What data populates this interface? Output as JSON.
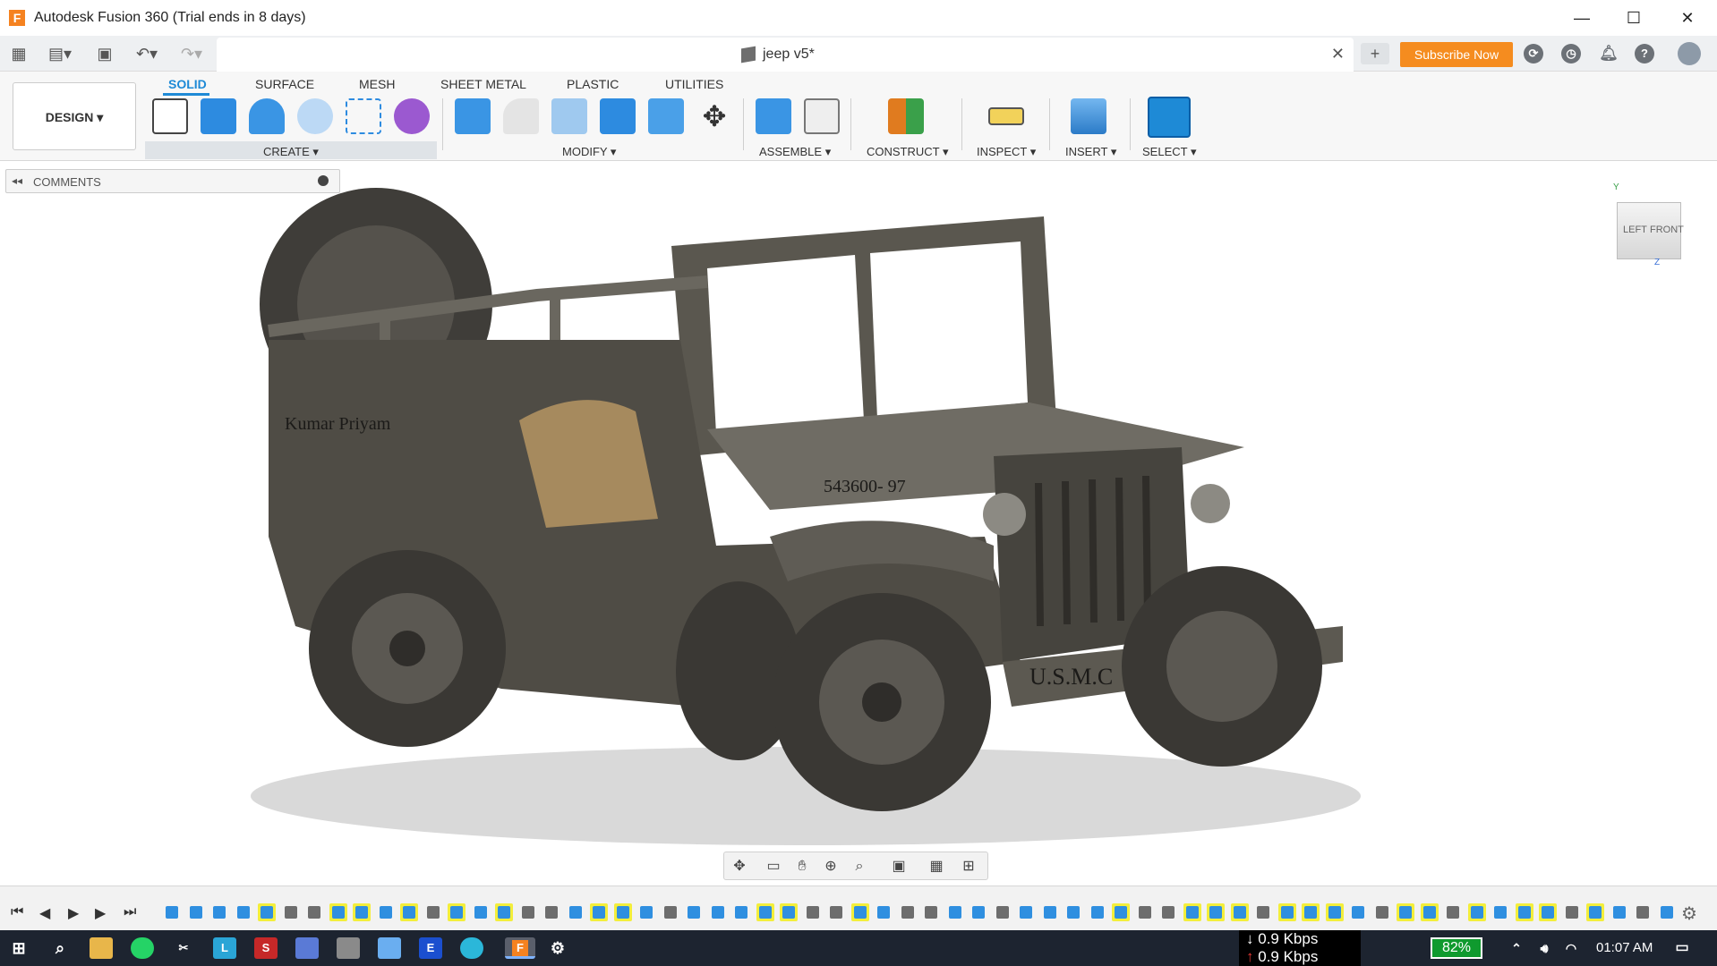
{
  "titlebar": {
    "title": "Autodesk Fusion 360 (Trial ends in 8 days)",
    "minimize": "—",
    "maximize": "☐",
    "close": "✕"
  },
  "tabbar": {
    "document_title": "jeep v5*",
    "subscribe_label": "Subscribe Now"
  },
  "ribbon": {
    "workspace": "DESIGN ▾",
    "tabs": [
      "SOLID",
      "SURFACE",
      "MESH",
      "SHEET METAL",
      "PLASTIC",
      "UTILITIES"
    ],
    "groups": [
      "CREATE ▾",
      "MODIFY ▾",
      "ASSEMBLE ▾",
      "CONSTRUCT ▾",
      "INSPECT ▾",
      "INSERT ▾",
      "SELECT ▾"
    ]
  },
  "comments": {
    "label": "COMMENTS"
  },
  "model": {
    "side_text": "Kumar Priyam",
    "hood_text": "543600- 97",
    "bumper_text": "U.S.M.C"
  },
  "viewcube": {
    "left": "LEFT",
    "front": "FRONT",
    "y_axis": "Y",
    "z_axis": "Z"
  },
  "taskbar": {
    "net_down": "0.9 Kbps",
    "net_up": "0.9 Kbps",
    "battery": "82%",
    "time": "01:07 AM"
  },
  "colors": {
    "accent": "#1e8ad6",
    "subscribe": "#f58c1f",
    "timeline_highlight": "#f3ee3b",
    "taskbar": "#1d2430"
  }
}
